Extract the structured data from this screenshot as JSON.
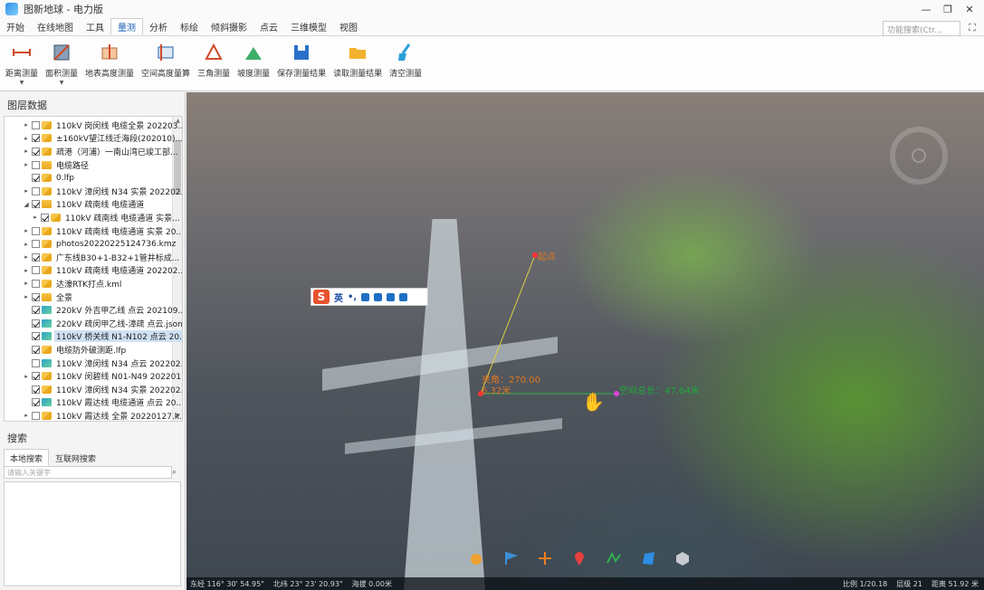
{
  "app": {
    "title": "图新地球 - 电力版"
  },
  "window": {
    "minimize": "—",
    "restore": "❐",
    "close": "✕"
  },
  "menu": {
    "tabs": [
      "开始",
      "在线地图",
      "工具",
      "量测",
      "分析",
      "标绘",
      "倾斜摄影",
      "点云",
      "三维模型",
      "视图"
    ],
    "active_index": 3,
    "search_placeholder": "功能搜索(Ctr..."
  },
  "ribbon": {
    "items": [
      {
        "label": "距离测量",
        "icon": "ruler-distance-icon",
        "dropdown": true
      },
      {
        "label": "面积测量",
        "icon": "area-measure-icon",
        "dropdown": true
      },
      {
        "label": "地表高度测量",
        "icon": "surface-height-icon",
        "dropdown": false
      },
      {
        "label": "空间高度量算",
        "icon": "space-height-icon",
        "dropdown": false
      },
      {
        "label": "三角测量",
        "icon": "triangle-measure-icon",
        "dropdown": false
      },
      {
        "label": "坡度测量",
        "icon": "slope-measure-icon",
        "dropdown": false
      },
      {
        "label": "保存测量结果",
        "icon": "save-icon",
        "dropdown": false
      },
      {
        "label": "读取测量结果",
        "icon": "folder-open-icon",
        "dropdown": false
      },
      {
        "label": "清空测量",
        "icon": "broom-icon",
        "dropdown": false
      }
    ]
  },
  "layers": {
    "title": "图层数据",
    "rows": [
      {
        "label": "110kV 岗闵线 电缆全景 202203...",
        "indent": 1,
        "expand": "▸",
        "checked": false,
        "icon": "cube"
      },
      {
        "label": "±160kV望江线迁海段(202010)...",
        "indent": 1,
        "expand": "▸",
        "checked": true,
        "icon": "cube"
      },
      {
        "label": "疏港（河浦）一南山湾已竣工部...",
        "indent": 1,
        "expand": "▸",
        "checked": true,
        "icon": "cube"
      },
      {
        "label": "电缆路径",
        "indent": 1,
        "expand": "▸",
        "checked": false,
        "icon": "folder"
      },
      {
        "label": "0.lfp",
        "indent": 1,
        "expand": "",
        "checked": true,
        "icon": "cube"
      },
      {
        "label": "110kV 漳闵线 N34 实景 202202...",
        "indent": 1,
        "expand": "▸",
        "checked": false,
        "icon": "cube"
      },
      {
        "label": "110kV 疏南线 电缆通道",
        "indent": 1,
        "expand": "◢",
        "checked": true,
        "icon": "folder"
      },
      {
        "label": "110kV 疏南线 电缆通道 实景...",
        "indent": 2,
        "expand": "▸",
        "checked": true,
        "icon": "cube"
      },
      {
        "label": "110kV 疏南线 电缆通道 实景 20...",
        "indent": 1,
        "expand": "▸",
        "checked": false,
        "icon": "cube"
      },
      {
        "label": "photos20220225124736.kmz",
        "indent": 1,
        "expand": "▸",
        "checked": false,
        "icon": "cube"
      },
      {
        "label": "广东线B30+1-B32+1管井标成...",
        "indent": 1,
        "expand": "▸",
        "checked": true,
        "icon": "cube"
      },
      {
        "label": "110kV 疏南线 电缆通道 202202...",
        "indent": 1,
        "expand": "▸",
        "checked": false,
        "icon": "cube"
      },
      {
        "label": "达濠RTK打点.kml",
        "indent": 1,
        "expand": "▸",
        "checked": false,
        "icon": "cube"
      },
      {
        "label": "全景",
        "indent": 1,
        "expand": "▸",
        "checked": true,
        "icon": "folder"
      },
      {
        "label": "220kV 外吉甲乙线 点云 202109...",
        "indent": 1,
        "expand": "",
        "checked": true,
        "icon": "cloud"
      },
      {
        "label": "220kV 疏闵甲乙线-漳疏 点云.json",
        "indent": 1,
        "expand": "",
        "checked": true,
        "icon": "cloud"
      },
      {
        "label": "110kV 桥关线 N1-N102 点云 20...",
        "indent": 1,
        "expand": "",
        "checked": true,
        "icon": "cloud",
        "selected": true
      },
      {
        "label": "电缆防外破测距.lfp",
        "indent": 1,
        "expand": "",
        "checked": true,
        "icon": "cube"
      },
      {
        "label": "110kV 漳闵线 N34 点云 202202...",
        "indent": 1,
        "expand": "",
        "checked": false,
        "icon": "cloud"
      },
      {
        "label": "110kV 闵碧线 N01-N49 202201...",
        "indent": 1,
        "expand": "▸",
        "checked": true,
        "icon": "cube"
      },
      {
        "label": "110kV 漳闵线 N34 实景 202202...",
        "indent": 1,
        "expand": "",
        "checked": true,
        "icon": "cube"
      },
      {
        "label": "110kV 霞达线 电缆通道 点云 20...",
        "indent": 1,
        "expand": "",
        "checked": true,
        "icon": "cloud"
      },
      {
        "label": "110kV 霞达线 全景 20220127.k...",
        "indent": 1,
        "expand": "▸",
        "checked": false,
        "icon": "cube"
      }
    ]
  },
  "search": {
    "title": "搜索",
    "tabs": [
      "本地搜索",
      "互联网搜索"
    ],
    "active_tab": 0,
    "placeholder": "请输入关键字"
  },
  "view": {
    "ime_text": "英",
    "label_start": "起点",
    "label_angle": "夹角：270.00",
    "label_seg": "6.32米",
    "label_total": "空间总长：47.64米"
  },
  "statusbar": {
    "lon": "东经 116° 30' 54.95\"",
    "lat": "北纬 23° 23' 20.93\"",
    "alt": "海拔 0.00米",
    "scale": "比例 1/20.18",
    "level": "层级 21",
    "distance": "距离 51.92 米"
  },
  "colors": {
    "accent": "#1a5fb4",
    "measure_line": "#e0d040",
    "measure_line2": "#2fb84c",
    "start_label": "#e07820",
    "total_label": "#1faa3c"
  }
}
